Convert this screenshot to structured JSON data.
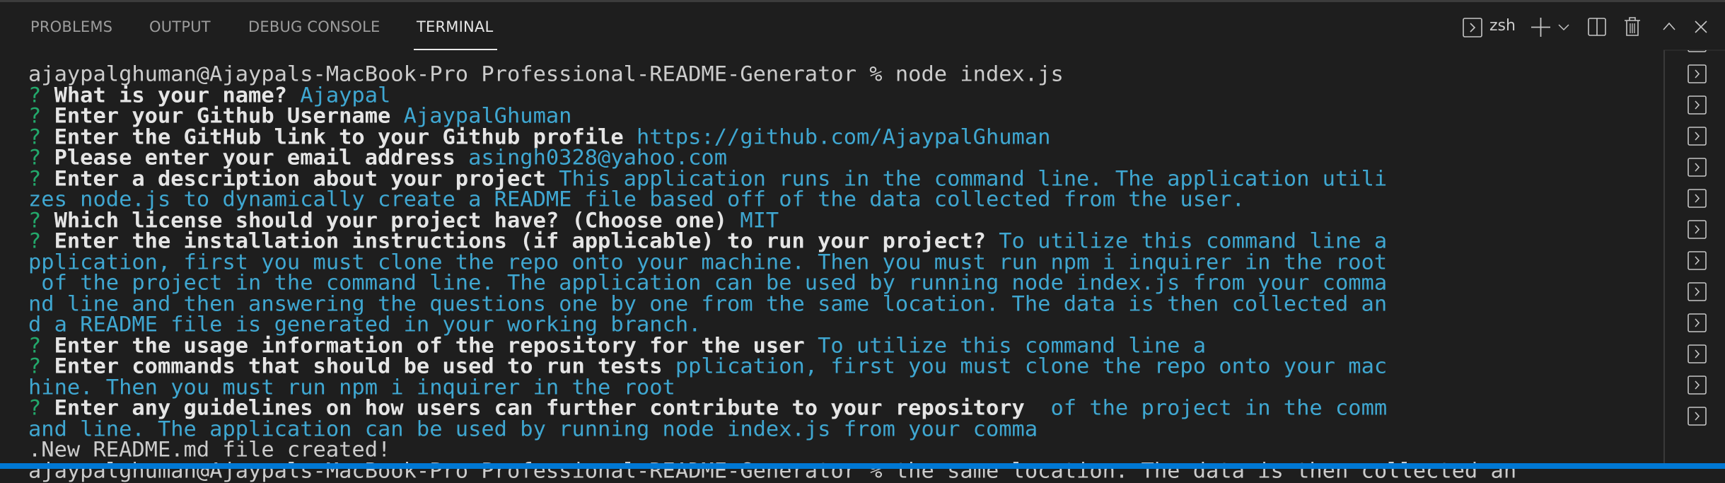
{
  "panel": {
    "tabs": [
      {
        "label": "PROBLEMS",
        "active": false
      },
      {
        "label": "OUTPUT",
        "active": false
      },
      {
        "label": "DEBUG CONSOLE",
        "active": false
      },
      {
        "label": "TERMINAL",
        "active": true
      }
    ],
    "toolbar": {
      "shell_name": "zsh",
      "icons": [
        "terminal-icon",
        "plus-icon",
        "chevron-down-icon",
        "split-icon",
        "trash-icon",
        "chevron-up-icon",
        "close-icon"
      ]
    }
  },
  "terminal": {
    "lines": [
      [
        {
          "t": "p",
          "s": "ajaypalghuman@Ajaypals-MacBook-Pro Professional-README-Generator % node index.js"
        }
      ],
      [
        {
          "t": "q",
          "s": "? "
        },
        {
          "t": "b",
          "s": "What is your name? "
        },
        {
          "t": "c",
          "s": "Ajaypal"
        }
      ],
      [
        {
          "t": "q",
          "s": "? "
        },
        {
          "t": "b",
          "s": "Enter your Github Username "
        },
        {
          "t": "c",
          "s": "AjaypalGhuman"
        }
      ],
      [
        {
          "t": "q",
          "s": "? "
        },
        {
          "t": "b",
          "s": "Enter the GitHub link to your Github profile "
        },
        {
          "t": "c",
          "s": "https://github.com/AjaypalGhuman"
        }
      ],
      [
        {
          "t": "q",
          "s": "? "
        },
        {
          "t": "b",
          "s": "Please enter your email address "
        },
        {
          "t": "c",
          "s": "asingh0328@yahoo.com"
        }
      ],
      [
        {
          "t": "q",
          "s": "? "
        },
        {
          "t": "b",
          "s": "Enter a description about your project "
        },
        {
          "t": "c",
          "s": "This application runs in the command line. The application utili"
        }
      ],
      [
        {
          "t": "c",
          "s": "zes node.js to dynamically create a README file based off of the data collected from the user."
        }
      ],
      [
        {
          "t": "q",
          "s": "? "
        },
        {
          "t": "b",
          "s": "Which license should your project have? (Choose one) "
        },
        {
          "t": "c",
          "s": "MIT"
        }
      ],
      [
        {
          "t": "q",
          "s": "? "
        },
        {
          "t": "b",
          "s": "Enter the installation instructions (if applicable) to run your project? "
        },
        {
          "t": "c",
          "s": "To utilize this command line a"
        }
      ],
      [
        {
          "t": "c",
          "s": "pplication, first you must clone the repo onto your machine. Then you must run npm i inquirer in the root"
        }
      ],
      [
        {
          "t": "c",
          "s": " of the project in the command line. The application can be used by running node index.js from your comma"
        }
      ],
      [
        {
          "t": "c",
          "s": "nd line and then answering the questions one by one from the same location. The data is then collected an"
        }
      ],
      [
        {
          "t": "c",
          "s": "d a README file is generated in your working branch."
        }
      ],
      [
        {
          "t": "q",
          "s": "? "
        },
        {
          "t": "b",
          "s": "Enter the usage information of the repository for the user "
        },
        {
          "t": "c",
          "s": "To utilize this command line a"
        }
      ],
      [
        {
          "t": "q",
          "s": "? "
        },
        {
          "t": "b",
          "s": "Enter commands that should be used to run tests "
        },
        {
          "t": "c",
          "s": "pplication, first you must clone the repo onto your mac"
        }
      ],
      [
        {
          "t": "c",
          "s": "hine. Then you must run npm i inquirer in the root"
        }
      ],
      [
        {
          "t": "q",
          "s": "? "
        },
        {
          "t": "b",
          "s": "Enter any guidelines on how users can further contribute to your repository "
        },
        {
          "t": "c",
          "s": " of the project in the comm"
        }
      ],
      [
        {
          "t": "c",
          "s": "and line. The application can be used by running node index.js from your comma"
        }
      ],
      [
        {
          "t": "p",
          "s": ".New README.md file created!"
        }
      ],
      [
        {
          "t": "p",
          "s": "ajaypalghuman@Ajaypals-MacBook-Pro Professional-README-Generator % the same location. The data is then collected an"
        }
      ]
    ]
  },
  "terminal_list": {
    "count": 13,
    "icon": "terminal-icon"
  },
  "colors": {
    "background": "#1e1e1e",
    "prompt_mark": "#23a86b",
    "answer": "#3fa7d1",
    "status_bar": "#0078d4"
  }
}
